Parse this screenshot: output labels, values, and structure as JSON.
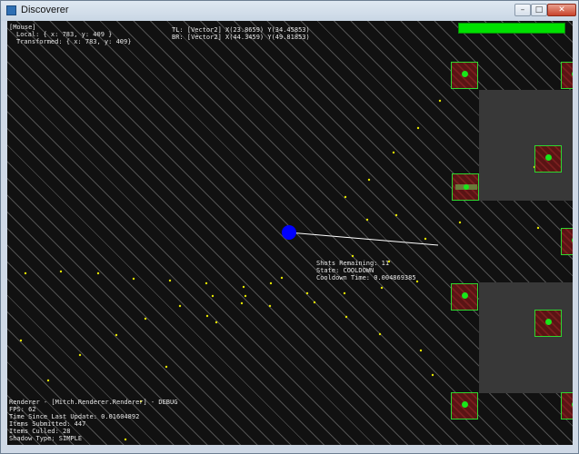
{
  "window": {
    "title": "Discoverer",
    "buttons": {
      "minimize": "–",
      "maximize": "□",
      "close": "✕"
    }
  },
  "hud": {
    "mouse_header": "[Mouse]",
    "mouse_local": "Local: { x: 783, y: 409 }",
    "mouse_transformed": "Transformed: { x: 783, y: 409}",
    "tl": "TL: [Vector2] X(23.8659) Y(34.45853)",
    "br": "BR: [Vector2] X(44.3459) Y(49.81853)",
    "shots": "Shots Remaining: 11",
    "state": "State: COOLDOWN",
    "cooldown": "Cooldown Time: 0.004869385",
    "renderer": "Renderer - [Mitch.Renderer.Renderer] - DEBUG",
    "fps": "FPS: 62",
    "since_update": "Time Since Last Update: 0.01604892",
    "submitted": "Items Submitted: 447",
    "culled": "Items Culled: 28",
    "shadow": "Shadow Type: SIMPLE"
  },
  "health": {
    "value": 1.0,
    "color": "#00e000"
  },
  "colors": {
    "player": "#0000ff",
    "star": "#e6e600",
    "tile_border": "#2fd62f"
  },
  "icons": {
    "player": "blue-circle",
    "aim": "white-line"
  }
}
